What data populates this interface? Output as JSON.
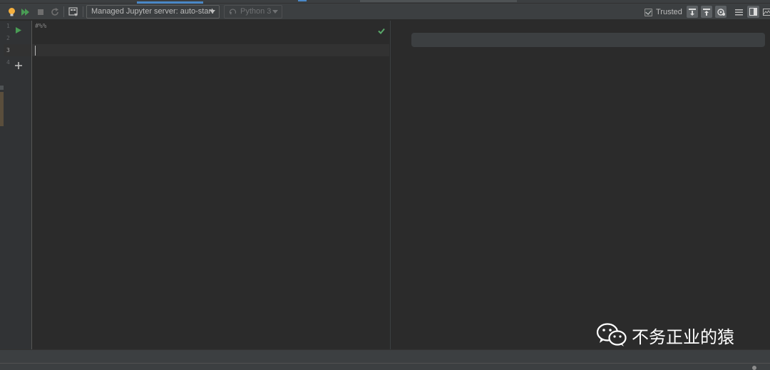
{
  "toolbar": {
    "run_icon": "lightbulb-icon",
    "jupyter_server_label": "Managed Jupyter server: auto-start",
    "kernel_label": "Python 3",
    "trusted_label": "Trusted",
    "trusted_checked": true
  },
  "editor": {
    "line_numbers": [
      "1",
      "2",
      "3",
      "4"
    ],
    "lines": [
      "#%%",
      "",
      ""
    ]
  },
  "watermark": {
    "text": "不务正业的猿"
  },
  "colors": {
    "run_green": "#499c54",
    "bulb_yellow": "#f4af3d",
    "check_green": "#59a869",
    "background": "#2b2b2b",
    "toolbar": "#3c3f41"
  }
}
